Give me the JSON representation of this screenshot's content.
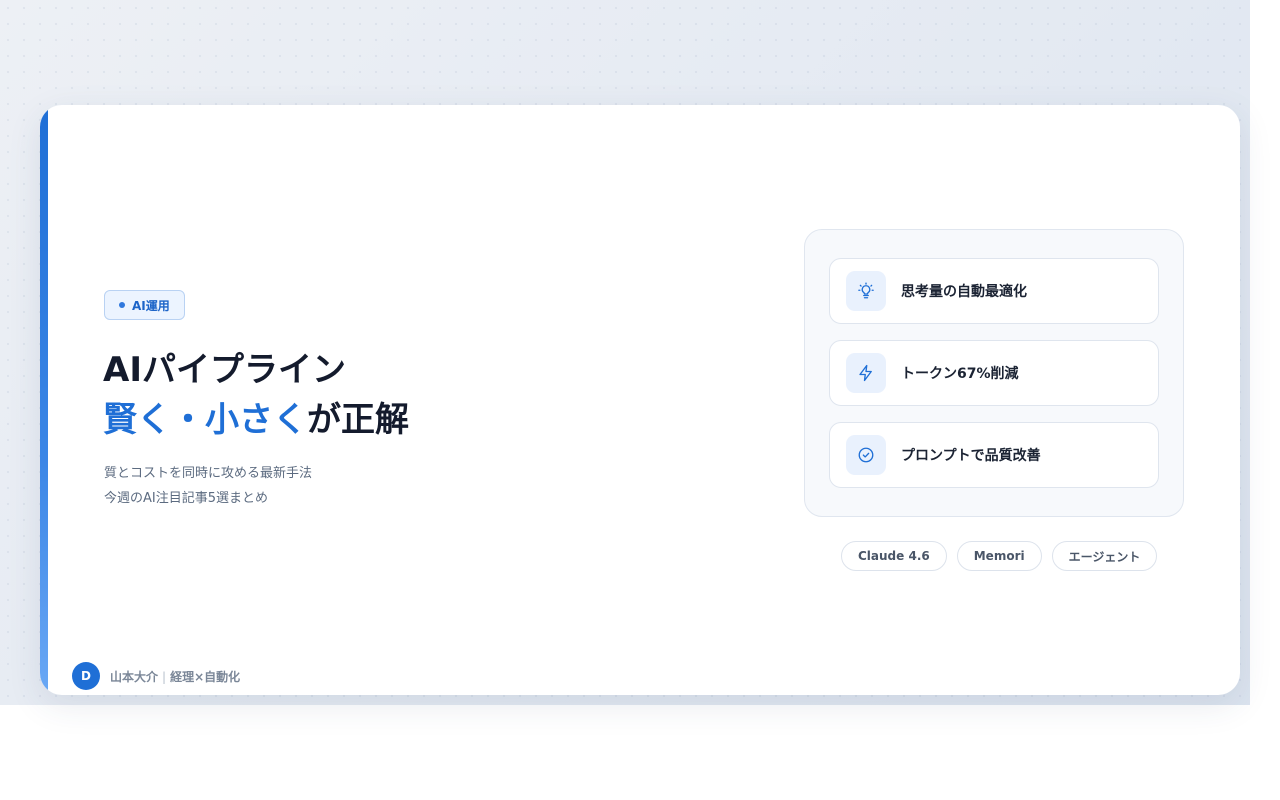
{
  "badge": {
    "label": "AI運用"
  },
  "headline": {
    "line1": "AIパイプライン",
    "line2_highlight": "賢く・小さく",
    "line2_rest": "が正解"
  },
  "subtitle": {
    "line1": "質とコストを同時に攻める最新手法",
    "line2": "今週のAI注目記事5選まとめ"
  },
  "features": [
    {
      "icon": "lightbulb-icon",
      "label": "思考量の自動最適化"
    },
    {
      "icon": "lightning-icon",
      "label": "トークン67%削減"
    },
    {
      "icon": "check-circle-icon",
      "label": "プロンプトで品質改善"
    }
  ],
  "tags": [
    "Claude 4.6",
    "Memori",
    "エージェント"
  ],
  "author": {
    "avatar_initial": "D",
    "name": "山本大介",
    "separator": "|",
    "role": "経理×自動化"
  },
  "colors": {
    "accent": "#1f6fd6",
    "heading": "#141b2d",
    "muted": "#5c6b80"
  }
}
